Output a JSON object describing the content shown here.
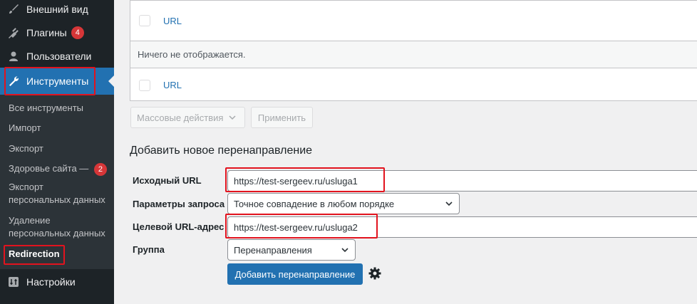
{
  "sidebar": {
    "items": [
      {
        "label": "Внешний вид",
        "icon": "brush-icon"
      },
      {
        "label": "Плагины",
        "icon": "plugin-icon",
        "badge": "4"
      },
      {
        "label": "Пользователи",
        "icon": "user-icon"
      },
      {
        "label": "Инструменты",
        "icon": "wrench-icon"
      },
      {
        "label": "Настройки",
        "icon": "settings-icon"
      }
    ],
    "submenu": [
      {
        "label": "Все инструменты"
      },
      {
        "label": "Импорт"
      },
      {
        "label": "Экспорт"
      },
      {
        "label": "Здоровье сайта —",
        "badge": "2"
      },
      {
        "label": "Экспорт",
        "label2": "персональных данных"
      },
      {
        "label": "Удаление",
        "label2": "персональных данных"
      },
      {
        "label": "Redirection"
      }
    ]
  },
  "table": {
    "row1_link": "URL",
    "empty_text": "Ничего не отображается.",
    "row3_link": "URL"
  },
  "bulk": {
    "actions_label": "Массовые действия",
    "apply_label": "Применить"
  },
  "form": {
    "title": "Добавить новое перенаправление",
    "source_label": "Исходный URL",
    "source_value": "https://test-sergeev.ru/usluga1",
    "query_label": "Параметры запроса",
    "query_value": "Точное совпадение в любом порядке",
    "target_label": "Целевой URL-адрес",
    "target_value": "https://test-sergeev.ru/usluga2",
    "group_label": "Группа",
    "group_value": "Перенаправления",
    "submit_label": "Добавить перенаправление"
  },
  "colors": {
    "accent": "#2271b1",
    "sidebar_bg": "#1d2327",
    "highlight_box": "#e2131e",
    "badge": "#d63638"
  }
}
